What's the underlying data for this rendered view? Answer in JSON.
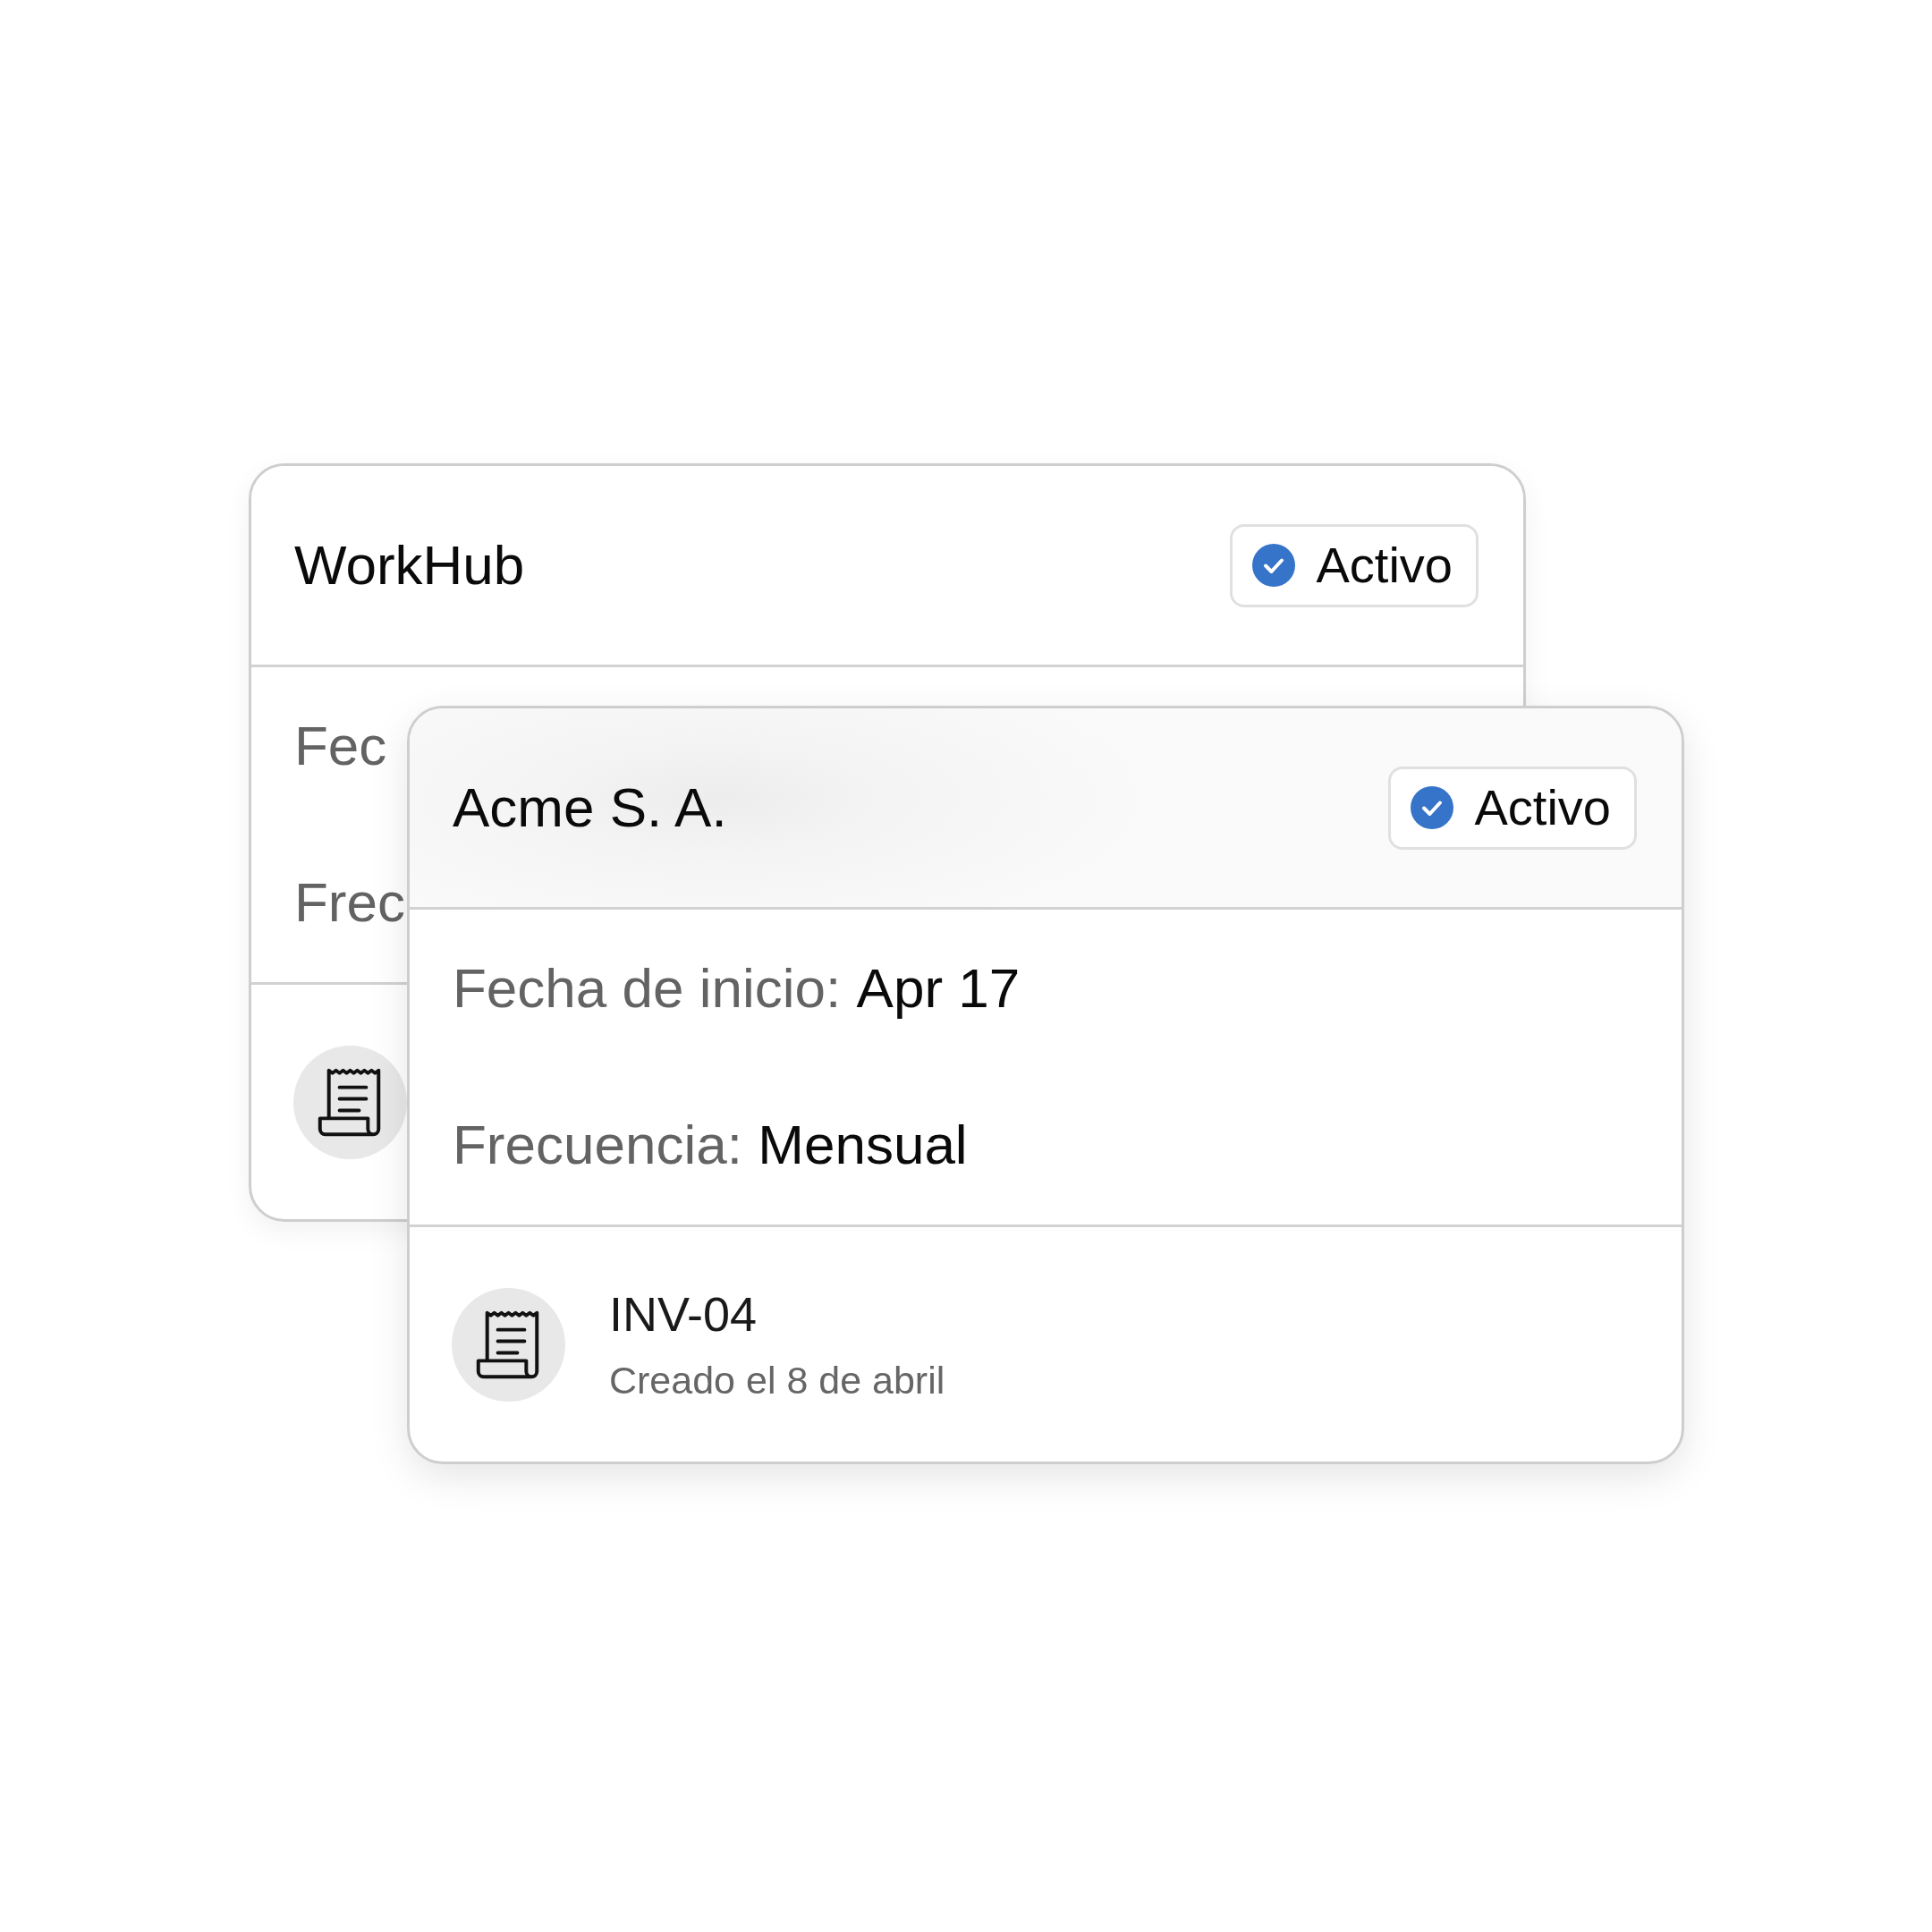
{
  "cards": [
    {
      "title": "WorkHub",
      "status": "Activo",
      "fields": [
        {
          "label": "Fec"
        },
        {
          "label": "Frec"
        }
      ]
    },
    {
      "title": "Acme S. A.",
      "status": "Activo",
      "fields": [
        {
          "label": "Fecha de inicio:",
          "value": "Apr 17"
        },
        {
          "label": "Frecuencia:",
          "value": "Mensual"
        }
      ],
      "invoice": {
        "number": "INV-04",
        "created": "Creado el 8 de abril"
      }
    }
  ]
}
